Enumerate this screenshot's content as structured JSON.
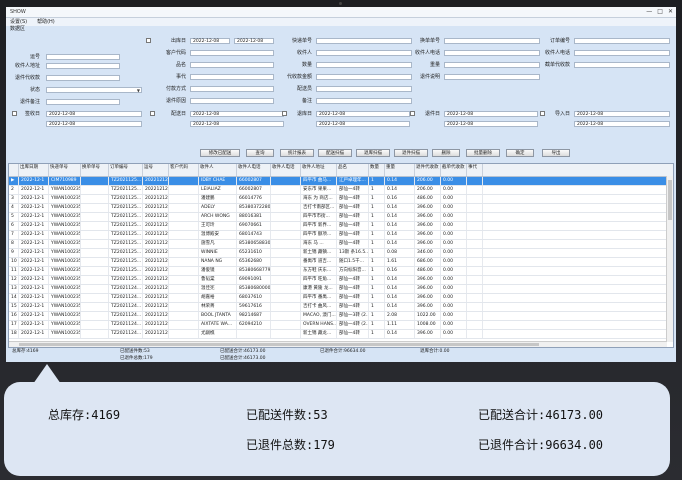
{
  "window": {
    "title": "SHOW"
  },
  "menu": [
    "设置(S)",
    "帮助(H)"
  ],
  "group_label": "数据区",
  "form": {
    "fields": [
      {
        "label": "出库日",
        "value": "2022-12-08"
      },
      {
        "label": "",
        "value": "2022-12-08"
      },
      {
        "label": "快递单号",
        "value": ""
      },
      {
        "label": "换单单号",
        "value": ""
      },
      {
        "label": "订单编号",
        "value": ""
      },
      {
        "label": "运号",
        "value": ""
      },
      {
        "label": "客户代码",
        "value": ""
      },
      {
        "label": "收件人",
        "value": ""
      },
      {
        "label": "收件人地址",
        "value": ""
      },
      {
        "label": "收件人电话",
        "value": ""
      },
      {
        "label": "收件人电话",
        "value": ""
      },
      {
        "label": "品名",
        "value": ""
      },
      {
        "label": "数量",
        "value": ""
      },
      {
        "label": "重量",
        "value": ""
      },
      {
        "label": "退件代收款",
        "value": ""
      },
      {
        "label": "截单代收款",
        "value": ""
      },
      {
        "label": "事代",
        "value": ""
      },
      {
        "label": "代收款金额",
        "value": ""
      },
      {
        "label": "退件说明",
        "value": ""
      },
      {
        "label": "状态",
        "value": ""
      },
      {
        "label": "付款方式",
        "value": ""
      },
      {
        "label": "配送员",
        "value": ""
      },
      {
        "label": "退件备注",
        "value": ""
      },
      {
        "label": "退件原因",
        "value": ""
      },
      {
        "label": "备注",
        "value": ""
      },
      {
        "label": "签收日",
        "value": "2022-12-08"
      },
      {
        "label": "配送日",
        "value": "2022-12-08"
      },
      {
        "label": "退库日",
        "value": "2022-12-08"
      },
      {
        "label": "退件日",
        "value": "2022-12-08"
      },
      {
        "label": "导入日",
        "value": "2022-12-08"
      }
    ]
  },
  "buttons": [
    "修改已配送",
    "查询",
    "统计报表",
    "配送扫描",
    "退库扫描",
    "退件扫描",
    "删除",
    "批量删除",
    "确定",
    "导出"
  ],
  "table": {
    "columns": [
      "",
      "出库日期",
      "快递单号",
      "换单单号",
      "订单编号",
      "运号",
      "客户代码",
      "收件人",
      "收件人电话",
      "收件人电话",
      "收件人地址",
      "品名",
      "数量",
      "重量",
      "退件代收款",
      "截单代收款",
      "事代"
    ],
    "rows": [
      [
        "▶",
        "2022-12-1",
        "CIM710989",
        "",
        "TZ2021125...",
        "2022121201",
        "",
        "IDBY CHAE",
        "66002807",
        "",
        "四平市 曲马...",
        "江戸卓理年...",
        "1",
        "0.14",
        "206.00",
        "0.00",
        ""
      ],
      [
        "2",
        "2022-12-1",
        "YWAN100235...",
        "",
        "TZ2021125...",
        "2022121201",
        "",
        "LEIALIAZ",
        "66002807",
        "",
        "安东市 果果...",
        "部仙一4转",
        "1",
        "0.14",
        "206.00",
        "0.00",
        ""
      ],
      [
        "3",
        "2022-12-1",
        "YWAN100235...",
        "",
        "TZ2021125...",
        "2022121201",
        "",
        "潘建鹏",
        "66014776",
        "",
        "海东 为 商店...",
        "部仙一4转",
        "1",
        "0.16",
        "486.00",
        "0.00",
        ""
      ],
      [
        "4",
        "2022-12-1",
        "YWAN100235...",
        "",
        "TZ2021125...",
        "2022121201",
        "",
        "ADELY",
        "85380372280",
        "",
        "吉打卡南部区...",
        "部仙一4转",
        "1",
        "0.14",
        "396.00",
        "0.00",
        ""
      ],
      [
        "5",
        "2022-12-1",
        "YWAN100235...",
        "",
        "TZ2021125...",
        "2022121201",
        "",
        "ARCH WONG",
        "88016381",
        "",
        "四平市市街...",
        "部仙一4转",
        "1",
        "0.14",
        "396.00",
        "0.00",
        ""
      ],
      [
        "6",
        "2022-12-1",
        "YWAN100235...",
        "",
        "TZ2021125...",
        "2022121201",
        "",
        "王可玲",
        "69070661",
        "",
        "四平市 新界...",
        "部仙一4转",
        "1",
        "0.14",
        "396.00",
        "0.00",
        ""
      ],
      [
        "7",
        "2022-12-1",
        "YWAN100235...",
        "",
        "TZ2021125...",
        "2022121201",
        "",
        "温博殿安",
        "68014743",
        "",
        "四平市 额项...",
        "部仙一4转",
        "1",
        "0.14",
        "396.00",
        "0.00",
        ""
      ],
      [
        "8",
        "2022-12-1",
        "YWAN100235...",
        "",
        "TZ2021125...",
        "2022121201",
        "",
        "施雪凡",
        "85380658830",
        "",
        "海东 马 ...",
        "部仙一4转",
        "1",
        "0.14",
        "396.00",
        "0.00",
        ""
      ],
      [
        "9",
        "2022-12-1",
        "YWAN100235...",
        "",
        "TZ2021125...",
        "2022121201",
        "",
        "WINNIE",
        "65231610",
        "",
        "新土锦 藏镇...",
        "13斯 条16.5...",
        "1",
        "0.08",
        "346.00",
        "0.00",
        ""
      ],
      [
        "10",
        "2022-12-1",
        "YWAN100235...",
        "",
        "TZ2021125...",
        "2022121201",
        "",
        "NANA NG",
        "65362680",
        "",
        "番禺市 道吉...",
        "随口1.5千...",
        "1",
        "1.61",
        "686.00",
        "0.00",
        ""
      ],
      [
        "11",
        "2022-12-1",
        "YWAN100235...",
        "",
        "TZ2021125...",
        "2022121201",
        "",
        "潘俊镜",
        "85380668779",
        "",
        "东方鞋 庆东...",
        "方向标阳音...",
        "1",
        "0.16",
        "486.00",
        "0.00",
        ""
      ],
      [
        "12",
        "2022-12-1",
        "YWAN100235...",
        "",
        "TZ2021125...",
        "2022121201",
        "",
        "鲁韬棠",
        "69091091",
        "",
        "四平市 旺角...",
        "部仙一4转",
        "1",
        "0.14",
        "396.00",
        "0.00",
        ""
      ],
      [
        "13",
        "2022-12-1",
        "YWAN100235...",
        "",
        "TZ2021124...",
        "2022121201",
        "",
        "温佳宪",
        "85380680000",
        "",
        "康港 黄陵 龙...",
        "部仙一4转",
        "1",
        "0.14",
        "396.00",
        "0.00",
        ""
      ],
      [
        "14",
        "2022-12-1",
        "YWAN100235...",
        "",
        "TZ2021124...",
        "2022121201",
        "",
        "胡嘉裕",
        "68037610",
        "",
        "四平市 番禺...",
        "部仙一4转",
        "1",
        "0.14",
        "396.00",
        "0.00",
        ""
      ],
      [
        "15",
        "2022-12-1",
        "YWAN100235...",
        "",
        "TZ2021124...",
        "2022121201",
        "",
        "林荣菁",
        "59617616",
        "",
        "吉打卡 曲风...",
        "部仙一4转",
        "1",
        "0.14",
        "396.00",
        "0.00",
        ""
      ],
      [
        "16",
        "2022-12-1",
        "YWAN100235...",
        "",
        "TZ2021124...",
        "2022121201",
        "",
        "BOOL JTANTA",
        "98214687",
        "",
        "MACAO, 澳门...",
        "部仙一3转 (2...",
        "1",
        "2.08",
        "1022.00",
        "0.00",
        ""
      ],
      [
        "17",
        "2022-12-1",
        "YWAN100235...",
        "",
        "TZ2021124...",
        "2022121201",
        "",
        "AIXTATE WA...",
        "62094210",
        "",
        "OVERN HANS...",
        "部仙一4转 (2...",
        "1",
        "1.11",
        "1008.00",
        "0.00",
        ""
      ],
      [
        "18",
        "2022-12-1",
        "YWAN100235...",
        "",
        "TZ2021124...",
        "2022121201",
        "",
        "尤嗣樵",
        "",
        "",
        "新土锦 藏龙...",
        "部仙一4转",
        "1",
        "0.14",
        "396.00",
        "0.00",
        ""
      ]
    ]
  },
  "statusbar": {
    "total_stock": "总库存:4169",
    "delivered_count": "已配送件数:53",
    "delivered_total": "已配送合计:46173.00",
    "returned_count": "已退件总数:179",
    "returned_total": "已退件合计:96634.00",
    "misc1": "已配送合计:46173.00",
    "misc2": "退库合计:0.00"
  },
  "callout": {
    "total_stock": "总库存:4169",
    "delivered_count": "已配送件数:53",
    "delivered_total": "已配送合计:46173.00",
    "returned_count": "已退件总数:179",
    "returned_total": "已退件合计:96634.00"
  }
}
